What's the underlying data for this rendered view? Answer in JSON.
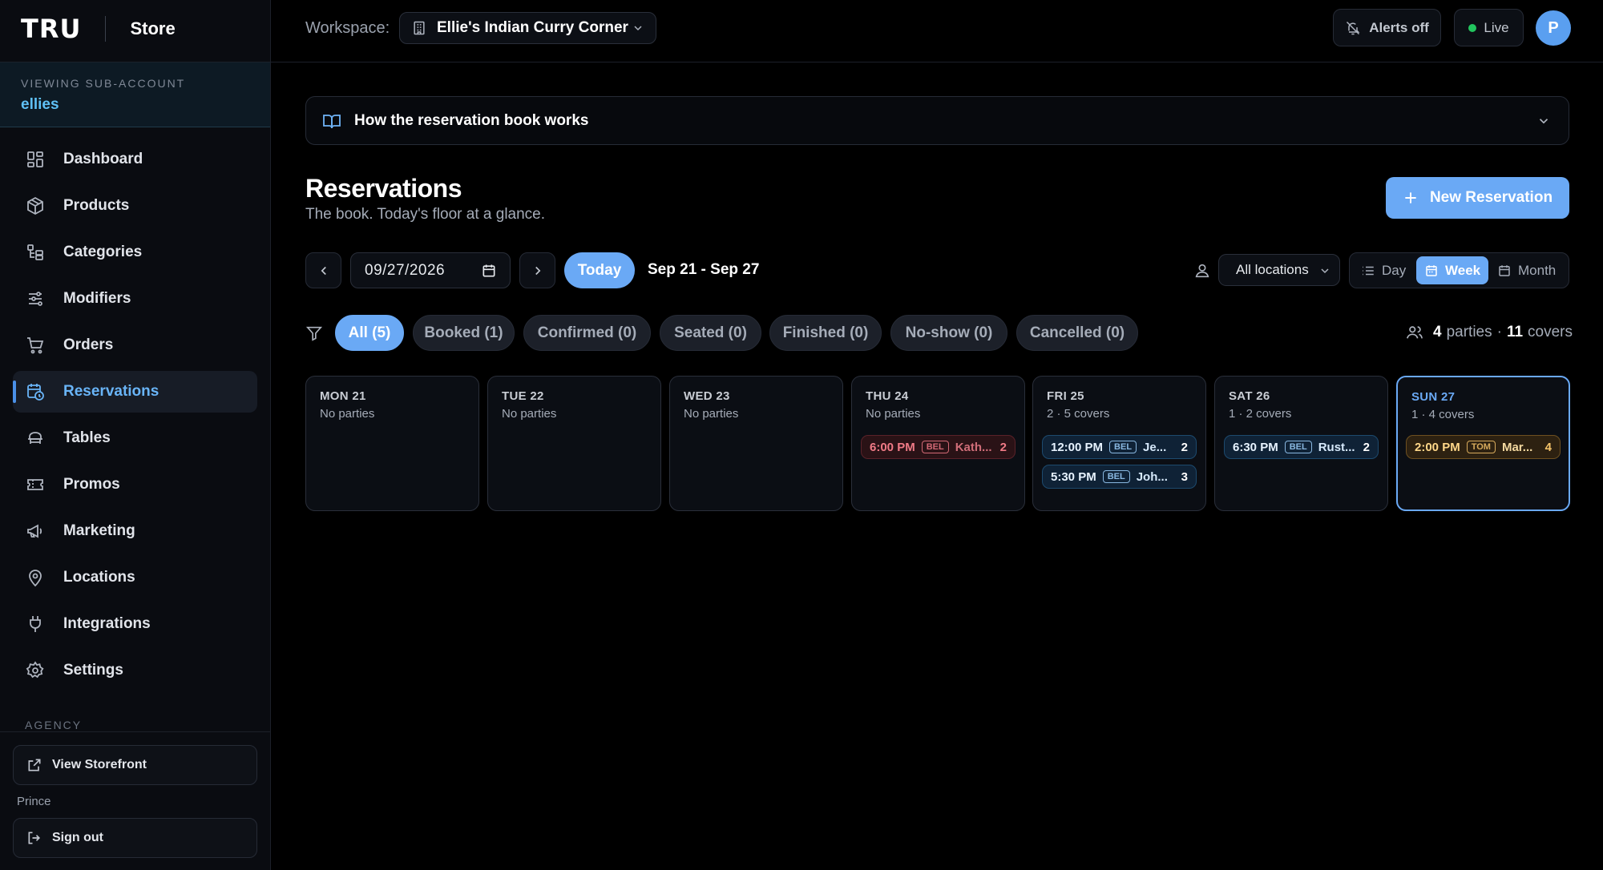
{
  "brand": {
    "logo": "TRU",
    "product": "Store"
  },
  "subaccount": {
    "label": "VIEWING SUB-ACCOUNT",
    "name": "ellies"
  },
  "nav": [
    {
      "label": "Dashboard",
      "icon": "dashboard-icon",
      "active": false
    },
    {
      "label": "Products",
      "icon": "box-icon",
      "active": false
    },
    {
      "label": "Categories",
      "icon": "categories-icon",
      "active": false
    },
    {
      "label": "Modifiers",
      "icon": "sliders-icon",
      "active": false
    },
    {
      "label": "Orders",
      "icon": "cart-icon",
      "active": false
    },
    {
      "label": "Reservations",
      "icon": "calendar-clock-icon",
      "active": true
    },
    {
      "label": "Tables",
      "icon": "table-icon",
      "active": false
    },
    {
      "label": "Promos",
      "icon": "ticket-icon",
      "active": false
    },
    {
      "label": "Marketing",
      "icon": "megaphone-icon",
      "active": false
    },
    {
      "label": "Locations",
      "icon": "map-pin-icon",
      "active": false
    },
    {
      "label": "Integrations",
      "icon": "plug-icon",
      "active": false
    },
    {
      "label": "Settings",
      "icon": "gear-icon",
      "active": false
    }
  ],
  "agency": {
    "label": "AGENCY",
    "view_storefront": "View Storefront",
    "user_name": "Prince",
    "sign_out": "Sign out"
  },
  "topbar": {
    "workspace_label": "Workspace:",
    "workspace_name": "Ellie's Indian Curry Corner",
    "alerts": "Alerts off",
    "live": "Live",
    "avatar_initial": "P"
  },
  "howto": {
    "title": "How the reservation book works"
  },
  "page": {
    "title": "Reservations",
    "subtitle": "The book. Today's floor at a glance.",
    "new_button": "New Reservation"
  },
  "controls": {
    "date": "09/27/2026",
    "today": "Today",
    "range": "Sep 21 - Sep 27",
    "location": "All locations",
    "views": [
      "Day",
      "Week",
      "Month"
    ],
    "active_view": "Week"
  },
  "filters": [
    {
      "label": "All (5)",
      "active": true
    },
    {
      "label": "Booked (1)",
      "active": false
    },
    {
      "label": "Confirmed (0)",
      "active": false
    },
    {
      "label": "Seated (0)",
      "active": false
    },
    {
      "label": "Finished (0)",
      "active": false
    },
    {
      "label": "No-show (0)",
      "active": false
    },
    {
      "label": "Cancelled (0)",
      "active": false
    }
  ],
  "summary": {
    "parties": "4",
    "parties_label": "parties",
    "sep": "·",
    "covers": "11",
    "covers_label": "covers"
  },
  "days": [
    {
      "name": "MON 21",
      "summary": "No parties",
      "today": false,
      "reservations": []
    },
    {
      "name": "TUE 22",
      "summary": "No parties",
      "today": false,
      "reservations": []
    },
    {
      "name": "WED 23",
      "summary": "No parties",
      "today": false,
      "reservations": []
    },
    {
      "name": "THU 24",
      "summary": "No parties",
      "today": false,
      "reservations": [
        {
          "time": "6:00 PM",
          "location": "BEL",
          "guest": "Kath...",
          "size": "2",
          "status": "booked"
        }
      ]
    },
    {
      "name": "FRI 25",
      "summary": "2 · 5 covers",
      "today": false,
      "reservations": [
        {
          "time": "12:00 PM",
          "location": "BEL",
          "guest": "Je...",
          "size": "2",
          "status": "confirmed"
        },
        {
          "time": "5:30 PM",
          "location": "BEL",
          "guest": "Joh...",
          "size": "3",
          "status": "confirmed"
        }
      ]
    },
    {
      "name": "SAT 26",
      "summary": "1 · 2 covers",
      "today": false,
      "reservations": [
        {
          "time": "6:30 PM",
          "location": "BEL",
          "guest": "Rust...",
          "size": "2",
          "status": "confirmed"
        }
      ]
    },
    {
      "name": "SUN 27",
      "summary": "1 · 4 covers",
      "today": true,
      "reservations": [
        {
          "time": "2:00 PM",
          "location": "TOM",
          "guest": "Mar...",
          "size": "4",
          "status": "pending"
        }
      ]
    }
  ],
  "colors": {
    "accent": "#6aa9f5",
    "booked": "#f07a86",
    "confirmed": "#9fd3ff",
    "pending": "#f6c46a",
    "live": "#22c55e"
  }
}
